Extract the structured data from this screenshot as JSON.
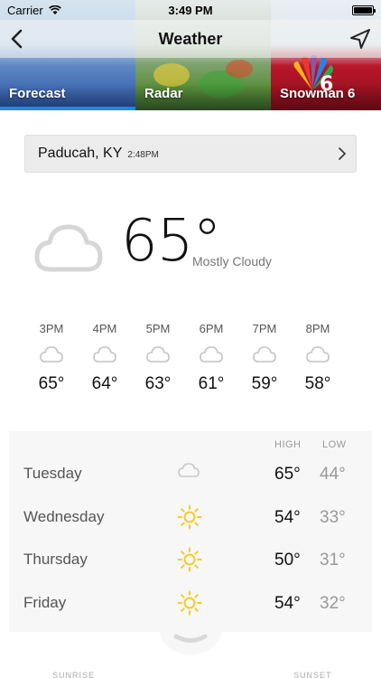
{
  "status_bar": {
    "carrier": "Carrier",
    "time": "3:49 PM"
  },
  "nav": {
    "title": "Weather"
  },
  "tabs": [
    {
      "label": "Forecast",
      "selected": true
    },
    {
      "label": "Radar",
      "selected": false
    },
    {
      "label": "Snowman 6",
      "selected": false
    }
  ],
  "location": {
    "city": "Paducah, KY",
    "updated": "2:48PM"
  },
  "current": {
    "temp": "65°",
    "condition": "Mostly Cloudy",
    "icon": "cloud-icon"
  },
  "hourly": [
    {
      "time": "3PM",
      "temp": "65°",
      "icon": "cloud-icon"
    },
    {
      "time": "4PM",
      "temp": "64°",
      "icon": "cloud-icon"
    },
    {
      "time": "5PM",
      "temp": "63°",
      "icon": "cloud-icon"
    },
    {
      "time": "6PM",
      "temp": "61°",
      "icon": "cloud-icon"
    },
    {
      "time": "7PM",
      "temp": "59°",
      "icon": "cloud-icon"
    },
    {
      "time": "8PM",
      "temp": "58°",
      "icon": "cloud-icon"
    }
  ],
  "daily": {
    "high_label": "HIGH",
    "low_label": "LOW",
    "days": [
      {
        "day": "Tuesday",
        "high": "65°",
        "low": "44°",
        "icon": "cloud-icon"
      },
      {
        "day": "Wednesday",
        "high": "54°",
        "low": "33°",
        "icon": "sun-icon"
      },
      {
        "day": "Thursday",
        "high": "50°",
        "low": "31°",
        "icon": "sun-icon"
      },
      {
        "day": "Friday",
        "high": "54°",
        "low": "32°",
        "icon": "sun-icon"
      }
    ]
  },
  "footer": {
    "sunrise_label": "SUNRISE",
    "sunset_label": "SUNSET"
  },
  "colors": {
    "accent": "#1e88e5",
    "sun": "#f2cc2a",
    "cloud": "#cfcfcf",
    "panel": "#f7f7f7"
  }
}
